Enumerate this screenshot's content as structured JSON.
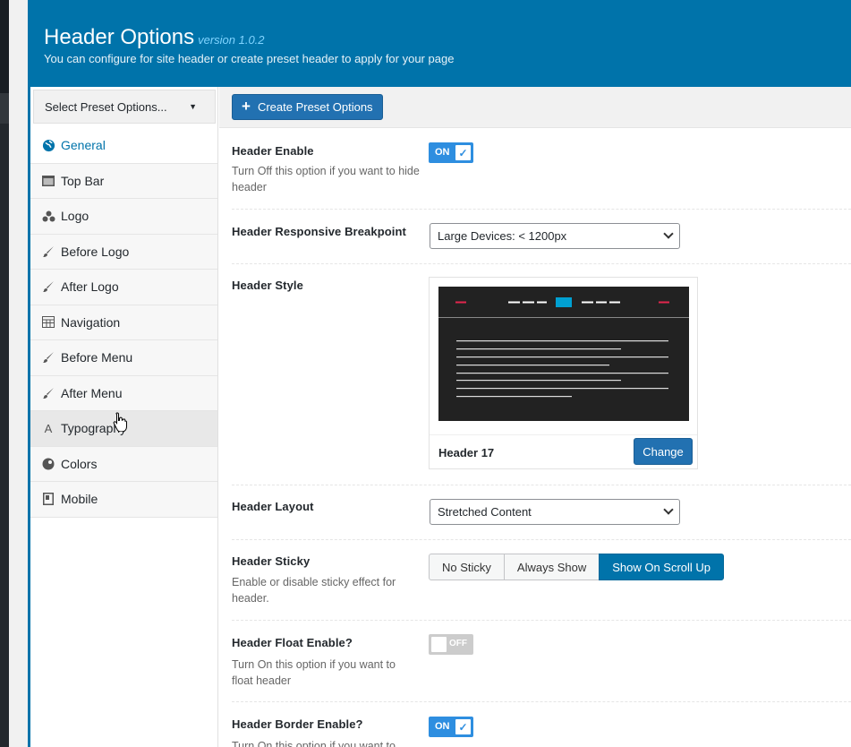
{
  "header": {
    "title": "Header Options",
    "version": "version 1.0.2",
    "subtitle": "You can configure for site header or create preset header to apply for your page"
  },
  "sidebar": {
    "preset_select": "Select Preset Options...",
    "items": [
      {
        "label": "General",
        "icon": "globe-icon",
        "active": true
      },
      {
        "label": "Top Bar",
        "icon": "window-icon"
      },
      {
        "label": "Logo",
        "icon": "cubes-icon"
      },
      {
        "label": "Before Logo",
        "icon": "brush-icon"
      },
      {
        "label": "After Logo",
        "icon": "brush-icon"
      },
      {
        "label": "Navigation",
        "icon": "grid-icon"
      },
      {
        "label": "Before Menu",
        "icon": "brush-icon"
      },
      {
        "label": "After Menu",
        "icon": "brush-icon"
      },
      {
        "label": "Typography",
        "icon": "font-icon",
        "hover": true
      },
      {
        "label": "Colors",
        "icon": "palette-icon"
      },
      {
        "label": "Mobile",
        "icon": "mobile-icon"
      }
    ]
  },
  "toolbar": {
    "create_label": "Create Preset Options"
  },
  "options": {
    "header_enable": {
      "label": "Header Enable",
      "desc": "Turn Off this option if you want to hide header",
      "state": "ON"
    },
    "breakpoint": {
      "label": "Header Responsive Breakpoint",
      "value": "Large Devices: < 1200px"
    },
    "style": {
      "label": "Header Style",
      "name": "Header 17",
      "change_label": "Change"
    },
    "layout": {
      "label": "Header Layout",
      "value": "Stretched Content"
    },
    "sticky": {
      "label": "Header Sticky",
      "desc": "Enable or disable sticky effect for header.",
      "options": [
        "No Sticky",
        "Always Show",
        "Show On Scroll Up"
      ],
      "selected": "Show On Scroll Up"
    },
    "float": {
      "label": "Header Float Enable?",
      "desc": "Turn On this option if you want to float header",
      "state": "OFF"
    },
    "border": {
      "label": "Header Border Enable?",
      "desc": "Turn On this option if you want to",
      "state": "ON"
    }
  },
  "colors": {
    "accent": "#0073aa",
    "toggle_on": "#2e8ee0",
    "preview_highlight": "#00a0d2",
    "preview_red": "#e2264d"
  }
}
